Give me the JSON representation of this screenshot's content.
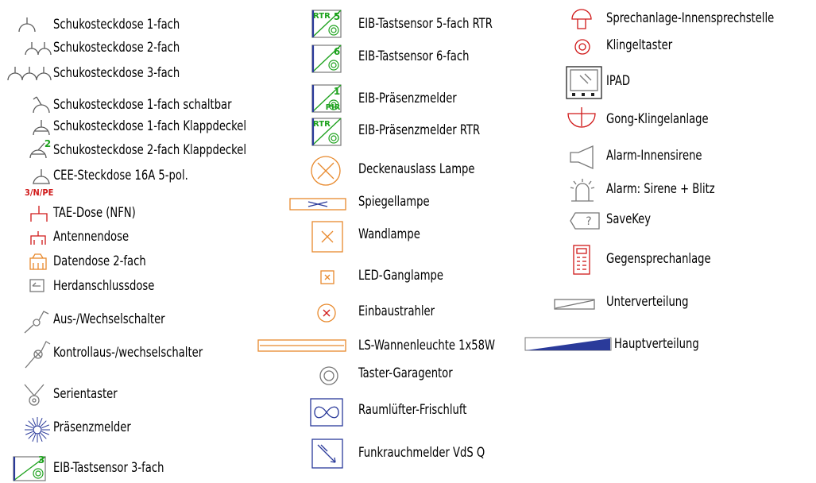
{
  "legend": {
    "items": [
      {
        "label": "Schukosteckdose 1-fach",
        "icon": "socket-1-icon"
      },
      {
        "label": "Schukosteckdose 2-fach",
        "icon": "socket-2-icon"
      },
      {
        "label": "Schukosteckdose 3-fach",
        "icon": "socket-3-icon"
      },
      {
        "label": "Schukosteckdose 1-fach schaltbar",
        "icon": "switched-socket-icon"
      },
      {
        "label": "Schukosteckdose 1-fach Klappdeckel",
        "icon": "flap-socket-icon"
      },
      {
        "label": "Schukosteckdose 2-fach Klappdeckel",
        "icon": "flap-socket-2-icon",
        "badge": "2"
      },
      {
        "label": "CEE-Steckdose 16A 5-pol.",
        "icon": "cee-socket-icon",
        "note": "3/N/PE"
      },
      {
        "label": "TAE-Dose (NFN)",
        "icon": "tae-socket-icon"
      },
      {
        "label": "Antennendose",
        "icon": "antenna-socket-icon"
      },
      {
        "label": "Datendose 2-fach",
        "icon": "data-socket-icon"
      },
      {
        "label": "Herdanschlussdose",
        "icon": "stove-outlet-icon"
      },
      {
        "label": "Aus-/Wechselschalter",
        "icon": "switch-icon"
      },
      {
        "label": "Kontrollaus-/wechselschalter",
        "icon": "control-switch-icon"
      },
      {
        "label": "Serientaster",
        "icon": "series-button-icon"
      },
      {
        "label": "Präsenzmelder",
        "icon": "presence-detector-icon"
      },
      {
        "label": "EIB-Tastsensor 3-fach",
        "icon": "eib-sensor-3-icon",
        "badge": "3"
      },
      {
        "label": "EIB-Tastsensor 5-fach RTR",
        "icon": "eib-sensor-5-icon",
        "tag": "RTR",
        "badge": "5"
      },
      {
        "label": "EIB-Tastsensor 6-fach",
        "icon": "eib-sensor-6-icon",
        "badge": "6"
      },
      {
        "label": "EIB-Präsenzmelder",
        "icon": "eib-presence-icon",
        "badge": "1",
        "tag": "PIR"
      },
      {
        "label": "EIB-Präsenzmelder RTR",
        "icon": "eib-presence-rtr-icon",
        "tag": "RTR"
      },
      {
        "label": "Deckenauslass Lampe",
        "icon": "ceiling-lamp-icon"
      },
      {
        "label": "Spiegellampe",
        "icon": "mirror-lamp-icon"
      },
      {
        "label": "Wandlampe",
        "icon": "wall-lamp-icon"
      },
      {
        "label": "LED-Ganglampe",
        "icon": "led-corridor-lamp-icon"
      },
      {
        "label": "Einbaustrahler",
        "icon": "recessed-spot-icon"
      },
      {
        "label": "LS-Wannenleuchte 1x58W",
        "icon": "trough-luminaire-icon"
      },
      {
        "label": "Taster-Garagentor",
        "icon": "garage-button-icon"
      },
      {
        "label": "Raumlüfter-Frischluft",
        "icon": "fan-icon"
      },
      {
        "label": "Funkrauchmelder VdS Q",
        "icon": "smoke-detector-icon"
      },
      {
        "label": "Sprechanlage-Innensprechstelle",
        "icon": "intercom-indoor-icon"
      },
      {
        "label": "Klingeltaster",
        "icon": "bell-button-icon"
      },
      {
        "label": "IPAD",
        "icon": "ipad-icon"
      },
      {
        "label": "Gong-Klingelanlage",
        "icon": "gong-icon"
      },
      {
        "label": "Alarm-Innensirene",
        "icon": "siren-icon"
      },
      {
        "label": "Alarm: Sirene + Blitz",
        "icon": "siren-flash-icon"
      },
      {
        "label": "SaveKey",
        "icon": "savekey-icon",
        "glyph": "?"
      },
      {
        "label": "Gegensprechanlage",
        "icon": "intercom-icon"
      },
      {
        "label": "Unterverteilung",
        "icon": "sub-distribution-icon"
      },
      {
        "label": "Hauptverteilung",
        "icon": "main-distribution-icon"
      }
    ]
  },
  "colors": {
    "text": "#000000",
    "socket": "#5a5a5a",
    "red": "#d01818",
    "green": "#1ea21e",
    "orange": "#e8892c",
    "blue": "#2a3a9a",
    "gray": "#777777"
  }
}
